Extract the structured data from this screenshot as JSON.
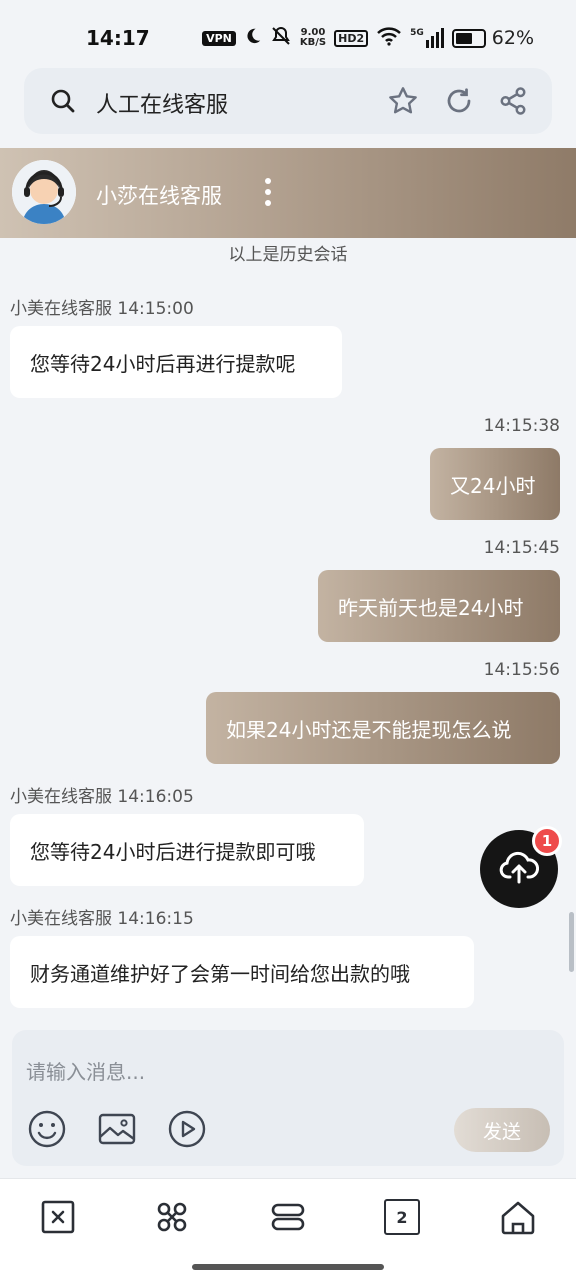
{
  "status": {
    "time": "14:17",
    "vpn": "VPN",
    "speed_value": "9.00",
    "speed_unit": "KB/S",
    "hd": "HD2",
    "network": "5G",
    "battery_level": 0.62,
    "battery_text": "62%"
  },
  "search": {
    "query": "人工在线客服"
  },
  "header": {
    "agent_name": "小莎在线客服"
  },
  "history_note": "以上是历史会话",
  "messages": [
    {
      "side": "in",
      "meta": "小美在线客服 14:15:00",
      "text": "您等待24小时后再进行提款呢"
    },
    {
      "side": "out",
      "meta": "14:15:38",
      "text": "又24小时"
    },
    {
      "side": "out",
      "meta": "14:15:45",
      "text": "昨天前天也是24小时"
    },
    {
      "side": "out",
      "meta": "14:15:56",
      "text": "如果24小时还是不能提现怎么说"
    },
    {
      "side": "in",
      "meta": "小美在线客服 14:16:05",
      "text": "您等待24小时后进行提款即可哦"
    },
    {
      "side": "in",
      "meta": "小美在线客服 14:16:15",
      "text": "财务通道维护好了会第一时间给您出款的哦"
    }
  ],
  "fab_badge": "1",
  "composer": {
    "placeholder": "请输入消息...",
    "send_label": "发送"
  },
  "nav": {
    "tabs_count": "2"
  },
  "colors": {
    "accent_dark": "#8e7a67",
    "accent_light": "#c3b3a2",
    "badge": "#ee4b4b"
  }
}
